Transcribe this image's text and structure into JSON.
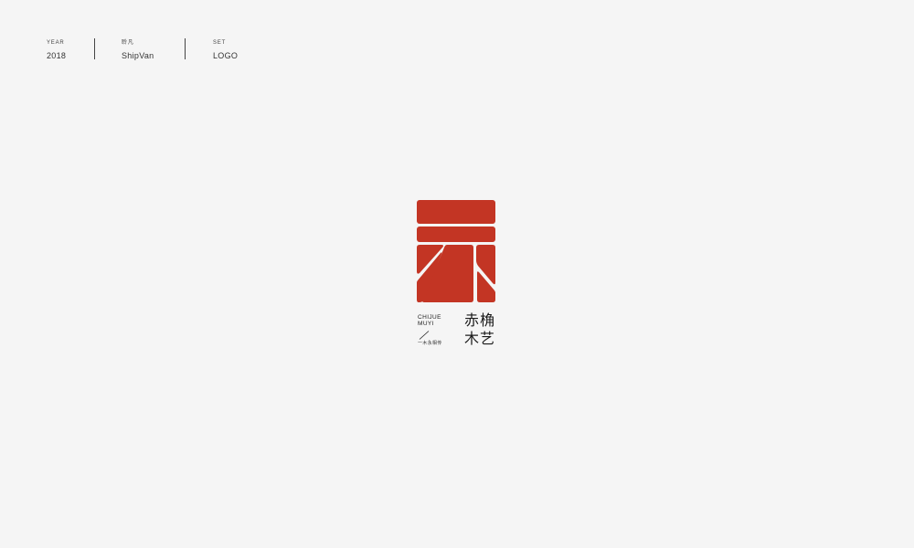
{
  "header": {
    "year": {
      "label": "YEAR",
      "value": "2018"
    },
    "author": {
      "label": "聆凡",
      "value": "ShipVan"
    },
    "set": {
      "label": "SET",
      "value": "LOGO"
    }
  },
  "logo": {
    "icon": "brand-logo-icon",
    "color": "#c33524",
    "latin_line_1": "CHIJUE",
    "latin_line_2": "MUYI",
    "tagline": "一木永相传",
    "cjk_line_1": "赤桷",
    "cjk_line_2": "木艺"
  }
}
